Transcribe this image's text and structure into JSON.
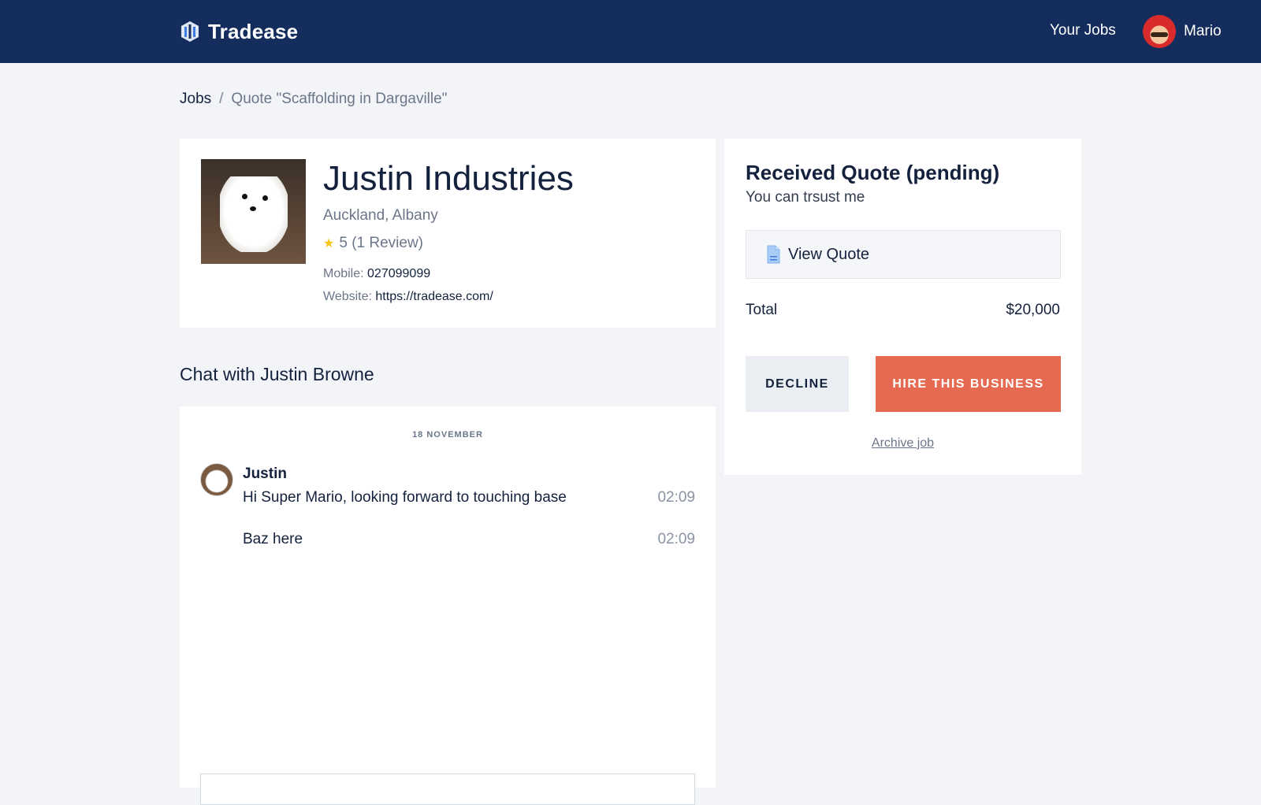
{
  "header": {
    "brand_name": "Tradease",
    "nav_your_jobs": "Your Jobs",
    "user_name": "Mario"
  },
  "breadcrumb": {
    "jobs": "Jobs",
    "separator": "/",
    "current": "Quote \"Scaffolding in Dargaville\""
  },
  "business": {
    "name": "Justin Industries",
    "location": "Auckland, Albany",
    "rating_text": "5 (1 Review)",
    "rating": 5,
    "mobile_label": "Mobile:",
    "mobile": "027099099",
    "website_label": "Website:",
    "website": "https://tradease.com/"
  },
  "chat": {
    "heading": "Chat with Justin Browne",
    "date": "18 NOVEMBER",
    "author": "Justin",
    "messages": [
      {
        "text": "Hi Super Mario, looking forward to touching base",
        "time": "02:09"
      },
      {
        "text": "Baz here",
        "time": "02:09"
      }
    ]
  },
  "quote": {
    "title": "Received Quote (pending)",
    "subtitle": "You can trsust me",
    "view_label": "View Quote",
    "total_label": "Total",
    "total_value": "$20,000",
    "decline_label": "DECLINE",
    "hire_label": "HIRE THIS BUSINESS",
    "archive_label": "Archive job"
  },
  "colors": {
    "header_bg": "#142d5c",
    "page_bg": "#f2f4f8",
    "accent_hire": "#e56a51",
    "star": "#f5c518"
  },
  "icons": {
    "brand": "tradease-logo-icon",
    "star": "star-icon",
    "document": "document-icon"
  }
}
